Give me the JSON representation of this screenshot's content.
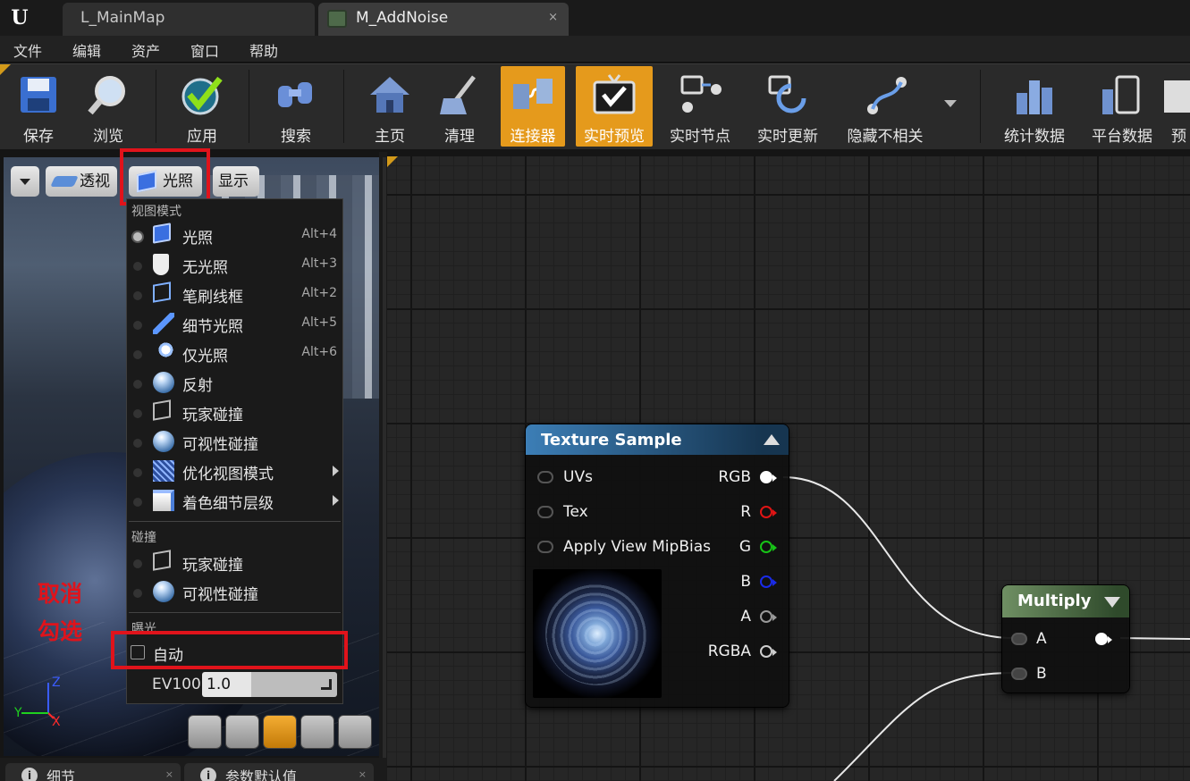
{
  "tabs": [
    {
      "label": "L_MainMap"
    },
    {
      "label": "M_AddNoise",
      "close": "×"
    }
  ],
  "menu": [
    "文件",
    "编辑",
    "资产",
    "窗口",
    "帮助"
  ],
  "toolbar": [
    {
      "label": "保存",
      "icon": "save-icon"
    },
    {
      "label": "浏览",
      "icon": "browse-icon"
    },
    {
      "label": "应用",
      "icon": "apply-icon"
    },
    {
      "label": "搜索",
      "icon": "search-icon"
    },
    {
      "label": "主页",
      "icon": "home-icon"
    },
    {
      "label": "清理",
      "icon": "clean-icon"
    },
    {
      "label": "连接器",
      "icon": "connector-icon",
      "active": true
    },
    {
      "label": "实时预览",
      "icon": "live-preview-icon",
      "active": true
    },
    {
      "label": "实时节点",
      "icon": "live-nodes-icon"
    },
    {
      "label": "实时更新",
      "icon": "live-update-icon"
    },
    {
      "label": "隐藏不相关",
      "icon": "hide-unrelated-icon"
    },
    {
      "label": "统计数据",
      "icon": "stats-icon"
    },
    {
      "label": "平台数据",
      "icon": "platform-stats-icon"
    },
    {
      "label": "预",
      "icon": "preview-icon"
    }
  ],
  "viewport": {
    "perspective_label": "透视",
    "lit_label": "光照",
    "show_label": "显示",
    "axis": {
      "z": "Z",
      "x": "X",
      "y": "Y"
    }
  },
  "lit_menu": {
    "view_mode_header": "视图模式",
    "view_modes": [
      {
        "label": "光照",
        "shortcut": "Alt+4",
        "selected": true,
        "icon": "lit-cube-icon"
      },
      {
        "label": "无光照",
        "shortcut": "Alt+3",
        "icon": "unlit-icon"
      },
      {
        "label": "笔刷线框",
        "shortcut": "Alt+2",
        "icon": "wireframe-icon"
      },
      {
        "label": "细节光照",
        "shortcut": "Alt+5",
        "icon": "detail-lighting-icon"
      },
      {
        "label": "仅光照",
        "shortcut": "Alt+6",
        "icon": "lighting-only-icon"
      },
      {
        "label": "反射",
        "shortcut": "",
        "icon": "reflection-icon"
      },
      {
        "label": "玩家碰撞",
        "shortcut": "",
        "icon": "player-collision-icon"
      },
      {
        "label": "可视性碰撞",
        "shortcut": "",
        "icon": "visibility-collision-icon"
      },
      {
        "label": "优化视图模式",
        "shortcut": "",
        "submenu": true,
        "icon": "optimization-icon"
      },
      {
        "label": "着色细节层级",
        "shortcut": "",
        "submenu": true,
        "icon": "lod-coloration-icon"
      }
    ],
    "collision_header": "碰撞",
    "collision_modes": [
      {
        "label": "玩家碰撞",
        "icon": "player-collision-icon"
      },
      {
        "label": "可视性碰撞",
        "icon": "visibility-collision-icon"
      }
    ],
    "exposure_header": "曝光",
    "auto_label": "自动",
    "auto_checked": false,
    "ev100_label": "EV100",
    "ev100_value": "1.0"
  },
  "annotation": "取消勾选",
  "bottom_tabs": [
    {
      "label": "细节",
      "info": "i",
      "close": "×"
    },
    {
      "label": "参数默认值",
      "info": "i",
      "close": "×"
    }
  ],
  "graph": {
    "texture_node": {
      "title": "Texture Sample",
      "inputs": [
        "UVs",
        "Tex",
        "Apply View MipBias"
      ],
      "outputs": [
        {
          "label": "RGB",
          "color": "#ffffff"
        },
        {
          "label": "R",
          "color": "#e01414"
        },
        {
          "label": "G",
          "color": "#17c317"
        },
        {
          "label": "B",
          "color": "#1a2be8"
        },
        {
          "label": "A",
          "color": "#9a9a9a"
        },
        {
          "label": "RGBA",
          "color": "#cfcfcf"
        }
      ]
    },
    "multiply_node": {
      "title": "Multiply",
      "inputs": [
        "A",
        "B"
      ]
    }
  },
  "colors": {
    "accent": "#e59a1c",
    "highlight": "#e0131b",
    "texture_header": "#3c7eb6",
    "multiply_header": "#6f8f63"
  }
}
